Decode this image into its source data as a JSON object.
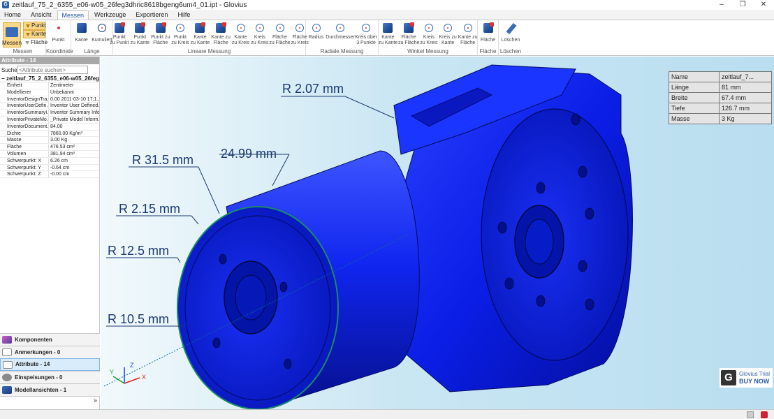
{
  "window": {
    "title": "zeitlauf_75_2_6355_e06-w05_26feg3dhric8618bgeng6um4_01.ipt - Glovius",
    "controls": [
      "–",
      "❐",
      "✕"
    ]
  },
  "tabs": [
    {
      "label": "Home",
      "active": false
    },
    {
      "label": "Ansicht",
      "active": false
    },
    {
      "label": "Messen",
      "active": true
    },
    {
      "label": "Werkzeuge",
      "active": false
    },
    {
      "label": "Exportieren",
      "active": false
    },
    {
      "label": "Hilfe",
      "active": false
    }
  ],
  "ribbon": {
    "messen_group": {
      "big_label": "Messen",
      "small": [
        {
          "label": "Punkt",
          "on": true
        },
        {
          "label": "Kante",
          "on": true
        },
        {
          "label": "Fläche",
          "on": false
        }
      ],
      "group_label": "Messen"
    },
    "koordinate": {
      "button": "Punkt",
      "group_label": "Koordinate"
    },
    "laenge": {
      "buttons": [
        "Kante",
        "Kumuliert"
      ],
      "group_label": "Länge"
    },
    "lineare": {
      "buttons": [
        [
          "Punkt",
          "zu Punkt"
        ],
        [
          "Punkt",
          "zu Kante"
        ],
        [
          "Punkt zu",
          "Fläche"
        ],
        [
          "Punkt",
          "zu Kreis"
        ],
        [
          "Kante",
          "zu Kante"
        ],
        [
          "Kante zu",
          "Fläche"
        ],
        [
          "Kante",
          "zu Kreis"
        ],
        [
          "Kreis",
          "zu Kreis"
        ],
        [
          "Fläche",
          "zu Fläche"
        ],
        [
          "Fläche",
          "zu Kreis"
        ]
      ],
      "group_label": "Lineare Messung"
    },
    "radiale": {
      "buttons": [
        [
          "Radius",
          ""
        ],
        [
          "Durchmesser",
          ""
        ],
        [
          "Kreis über",
          "3 Punkte"
        ]
      ],
      "group_label": "Radiale Messung"
    },
    "winkel": {
      "buttons": [
        [
          "Kante",
          "zu Kante"
        ],
        [
          "Fläche",
          "zu Fläche"
        ],
        [
          "Kreis",
          "zu Kreis"
        ],
        [
          "Kreis zu",
          "Kante"
        ],
        [
          "Kante zu",
          "Fläche"
        ]
      ],
      "group_label": "Winkel Messung"
    },
    "flaeche": {
      "button": "Fläche",
      "group_label": "Fläche"
    },
    "loeschen": {
      "button": "Löschen",
      "group_label": "Löschen"
    }
  },
  "panel": {
    "header": "Attribute - 14",
    "search_label": "Suche:",
    "search_placeholder": "<Attribute suchen>",
    "root": "zeitlauf_75_2_6355_e06-w05_26feg...",
    "attributes": [
      {
        "k": "Einheit",
        "v": "Zentimeter"
      },
      {
        "k": "Modellierer",
        "v": "Unbekannt"
      },
      {
        "k": "InventorDesignTra...",
        "v": "0.00 2011-03-10 17:1..."
      },
      {
        "k": "InventorUserDefin...",
        "v": "Inventor User Defined..."
      },
      {
        "k": "InventorSummaryI...",
        "v": "Inventor Summary Info..."
      },
      {
        "k": "InventorPrivateMo...",
        "v": "_Private Model Inform..."
      },
      {
        "k": "InventorDocument...",
        "v": "84.00"
      },
      {
        "k": "Dichte",
        "v": "7860.00 Kg/m³"
      },
      {
        "k": "Masse",
        "v": "3.00 Kg"
      },
      {
        "k": "Fläche",
        "v": "476.53 cm²"
      },
      {
        "k": "Volumen",
        "v": "381.94 cm³"
      },
      {
        "k": "Schwerpunkt: X",
        "v": "6.26 cm"
      },
      {
        "k": "Schwerpunkt: Y",
        "v": "-0.64 cm"
      },
      {
        "k": "Schwerpunkt: Z",
        "v": "-0.00 cm"
      }
    ],
    "bottom_tabs": [
      {
        "label": "Komponenten",
        "icon": "components-icon",
        "active": false
      },
      {
        "label": "Anmerkungen - 0",
        "icon": "annotations-icon",
        "active": false
      },
      {
        "label": "Attribute - 14",
        "icon": "attributes-icon",
        "active": true
      },
      {
        "label": "Einspeisungen - 0",
        "icon": "feeds-icon",
        "active": false
      },
      {
        "label": "Modellansichten - 1",
        "icon": "model-views-icon",
        "active": false
      }
    ],
    "footer_glyph": "»"
  },
  "viewport": {
    "dimensions": [
      "R 2.07  mm",
      "24.99  mm",
      "R 31.5  mm",
      "R 2.15  mm",
      "R 12.5  mm",
      "R 10.5  mm"
    ],
    "info_table": [
      {
        "k": "Name",
        "v": "zeitlauf_7..."
      },
      {
        "k": "Länge",
        "v": "81 mm"
      },
      {
        "k": "Breite",
        "v": "67.4 mm"
      },
      {
        "k": "Tiefe",
        "v": "126.7 mm"
      },
      {
        "k": "Masse",
        "v": "3  Kg"
      }
    ],
    "axes": {
      "x": "X",
      "y": "Y",
      "z": "Z"
    },
    "trial": {
      "logo": "G",
      "line1": "Glovius Trial",
      "line2": "BUY NOW"
    },
    "model_color": "#0a1ee6"
  }
}
